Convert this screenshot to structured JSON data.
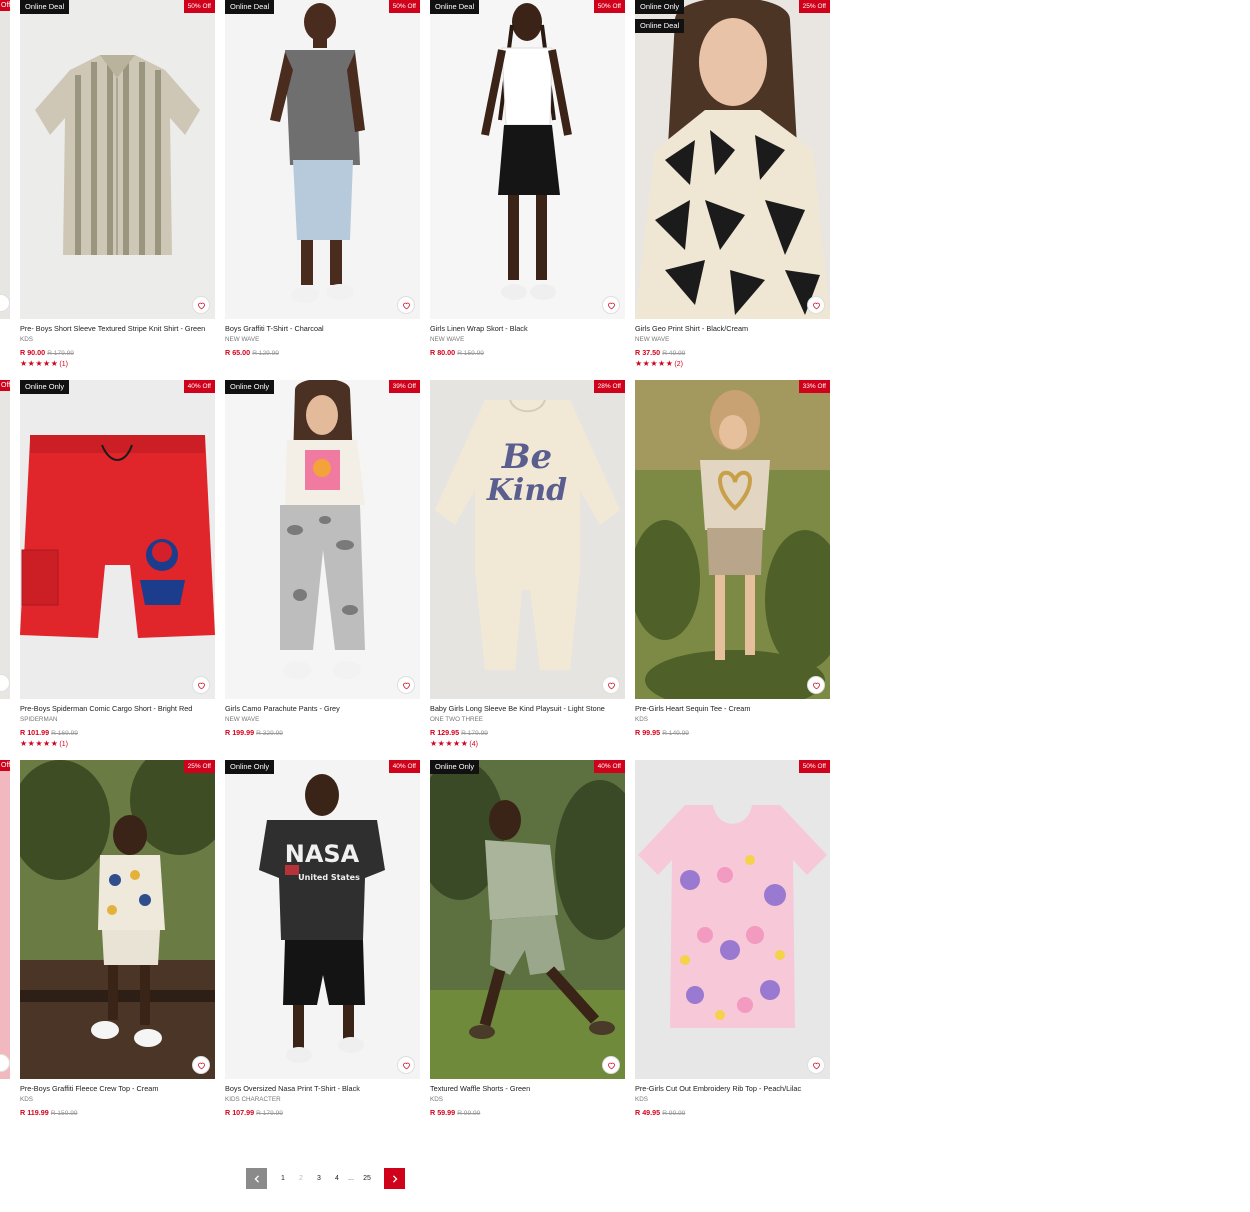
{
  "colors": {
    "accent": "#d0021b",
    "badge_dark": "#111111",
    "muted": "#777777"
  },
  "edge_badge": "Off",
  "products": [
    {
      "deal_badges": [
        "Online Deal"
      ],
      "discount": "50% Off",
      "title": "Pre- Boys Short Sleeve Textured Stripe Knit Shirt - Green",
      "brand": "KDS",
      "price": "R 90.00",
      "was": "R 179.99",
      "stars": "★★★★★",
      "rating_count": "(1)"
    },
    {
      "deal_badges": [
        "Online Deal"
      ],
      "discount": "50% Off",
      "title": "Boys Graffiti T-Shirt - Charcoal",
      "brand": "NEW WAVE",
      "price": "R 65.00",
      "was": "R 129.99",
      "stars": "",
      "rating_count": ""
    },
    {
      "deal_badges": [
        "Online Deal"
      ],
      "discount": "50% Off",
      "title": "Girls Linen Wrap Skort - Black",
      "brand": "NEW WAVE",
      "price": "R 80.00",
      "was": "R 159.99",
      "stars": "",
      "rating_count": ""
    },
    {
      "deal_badges": [
        "Online Only",
        "Online Deal"
      ],
      "discount": "25% Off",
      "title": "Girls Geo Print Shirt - Black/Cream",
      "brand": "NEW WAVE",
      "price": "R 37.50",
      "was": "R 49.99",
      "stars": "★★★★★",
      "rating_count": "(2)"
    },
    {
      "deal_badges": [
        "Online Only"
      ],
      "discount": "40% Off",
      "title": "Pre-Boys Spiderman Comic Cargo Short - Bright Red",
      "brand": "SPIDERMAN",
      "price": "R 101.99",
      "was": "R 169.99",
      "stars": "★★★★★",
      "rating_count": "(1)"
    },
    {
      "deal_badges": [
        "Online Only"
      ],
      "discount": "39% Off",
      "title": "Girls Camo Parachute Pants - Grey",
      "brand": "NEW WAVE",
      "price": "R 199.99",
      "was": "R 329.99",
      "stars": "",
      "rating_count": ""
    },
    {
      "deal_badges": [],
      "discount": "28% Off",
      "title": "Baby Girls Long Sleeve Be Kind Playsuit - Light Stone",
      "brand": "ONE TWO THREE",
      "price": "R 129.95",
      "was": "R 179.99",
      "stars": "★★★★★",
      "rating_count": "(4)",
      "print_text_1": "Be",
      "print_text_2": "Kind"
    },
    {
      "deal_badges": [],
      "discount": "33% Off",
      "title": "Pre-Girls Heart Sequin Tee - Cream",
      "brand": "KDS",
      "price": "R 99.95",
      "was": "R 149.99",
      "stars": "",
      "rating_count": ""
    },
    {
      "deal_badges": [],
      "discount": "25% Off",
      "title": "Pre-Boys Graffiti Fleece Crew Top - Cream",
      "brand": "KDS",
      "price": "R 119.99",
      "was": "R 159.99",
      "stars": "",
      "rating_count": ""
    },
    {
      "deal_badges": [
        "Online Only"
      ],
      "discount": "40% Off",
      "title": "Boys Oversized Nasa Print T-Shirt - Black",
      "brand": "KIDS CHARACTER",
      "price": "R 107.99",
      "was": "R 179.99",
      "stars": "",
      "rating_count": "",
      "print_text_1": "NASA",
      "print_text_2": "United States"
    },
    {
      "deal_badges": [
        "Online Only"
      ],
      "discount": "40% Off",
      "title": "Textured Waffle Shorts - Green",
      "brand": "KDS",
      "price": "R 59.99",
      "was": "R 99.99",
      "stars": "",
      "rating_count": ""
    },
    {
      "deal_badges": [],
      "discount": "50% Off",
      "title": "Pre-Girls Cut Out Embroidery Rib Top - Peach/Lilac",
      "brand": "KDS",
      "price": "R 49.95",
      "was": "R 99.99",
      "stars": "",
      "rating_count": ""
    }
  ],
  "pagination": {
    "pages": [
      "1",
      "2",
      "3",
      "4"
    ],
    "current_index": 1,
    "ellipsis": "...",
    "last_page": "25"
  }
}
